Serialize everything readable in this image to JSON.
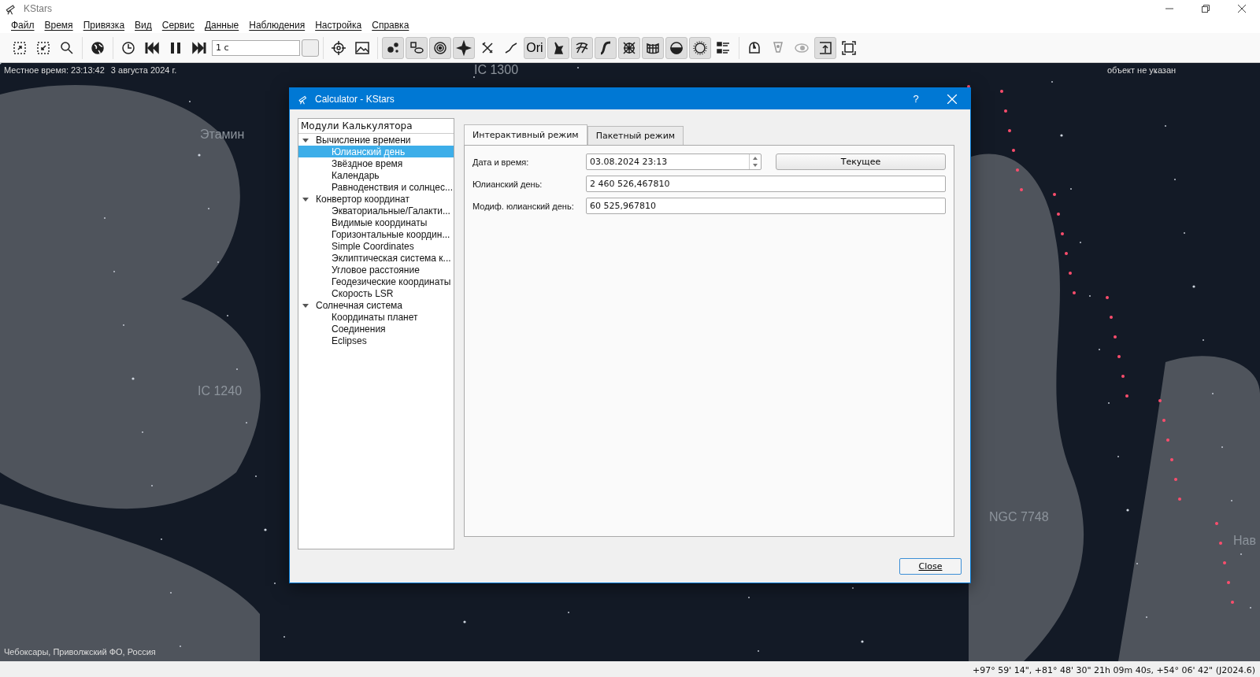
{
  "window": {
    "title": "KStars"
  },
  "menu": [
    "Файл",
    "Время",
    "Привязка",
    "Вид",
    "Сервис",
    "Данные",
    "Наблюдения",
    "Настройка",
    "Справка"
  ],
  "toolbar": {
    "groups": [
      [
        {
          "kind": "icon",
          "pressed": false
        },
        {
          "kind": "icon",
          "pressed": false
        },
        {
          "kind": "icon",
          "pressed": false
        }
      ],
      [
        {
          "kind": "icon",
          "pressed": false
        }
      ],
      [
        {
          "kind": "icon",
          "pressed": false
        },
        {
          "kind": "icon",
          "pressed": false
        },
        {
          "kind": "icon",
          "pressed": false
        },
        {
          "kind": "icon",
          "pressed": false
        },
        {
          "kind": "spin",
          "value": "1 с"
        }
      ],
      [
        {
          "kind": "icon",
          "pressed": false
        },
        {
          "kind": "icon",
          "pressed": false
        }
      ],
      [
        {
          "kind": "icon",
          "pressed": true
        },
        {
          "kind": "icon",
          "pressed": true
        },
        {
          "kind": "icon",
          "pressed": true
        },
        {
          "kind": "icon",
          "pressed": true
        },
        {
          "kind": "icon",
          "pressed": false
        },
        {
          "kind": "icon",
          "pressed": false
        },
        {
          "kind": "text",
          "label": "Ori",
          "pressed": true
        },
        {
          "kind": "icon",
          "pressed": true
        },
        {
          "kind": "icon",
          "pressed": true
        },
        {
          "kind": "icon",
          "pressed": true
        },
        {
          "kind": "icon",
          "pressed": true
        },
        {
          "kind": "icon",
          "pressed": true
        },
        {
          "kind": "icon",
          "pressed": true
        },
        {
          "kind": "icon",
          "pressed": true
        },
        {
          "kind": "icon",
          "pressed": false
        }
      ],
      [
        {
          "kind": "icon",
          "pressed": false
        },
        {
          "kind": "icon",
          "pressed": false
        },
        {
          "kind": "icon",
          "pressed": false
        },
        {
          "kind": "icon",
          "pressed": true
        },
        {
          "kind": "icon",
          "pressed": false
        }
      ]
    ]
  },
  "sky": {
    "local_time": "Местное время: 23:13:42",
    "date": "3 августа 2024 г.",
    "focus": "объект не указан",
    "location": "Чебоксары, Приволжский ФО, Россия",
    "labels": [
      "IC 1300",
      "Этамин",
      "IC 1240",
      "NGC 7748",
      "Нав"
    ]
  },
  "dialog": {
    "title": "Calculator - KStars",
    "help": "?",
    "tree": {
      "header": "Модули Калькулятора",
      "items": [
        {
          "label": "Вычисление времени",
          "expanded": true,
          "selected": false,
          "children": [
            {
              "label": "Юлианский день",
              "selected": true
            },
            {
              "label": "Звёздное время",
              "selected": false
            },
            {
              "label": "Календарь",
              "selected": false
            },
            {
              "label": "Равноденствия и солнцес...",
              "selected": false
            }
          ]
        },
        {
          "label": "Конвертор координат",
          "expanded": true,
          "selected": false,
          "children": [
            {
              "label": "Экваториальные/Галакти...",
              "selected": false
            },
            {
              "label": "Видимые координаты",
              "selected": false
            },
            {
              "label": "Горизонтальные координ...",
              "selected": false
            },
            {
              "label": "Simple Coordinates",
              "selected": false
            },
            {
              "label": "Эклиптическая система к...",
              "selected": false
            },
            {
              "label": "Угловое расстояние",
              "selected": false
            },
            {
              "label": "Геодезические координаты",
              "selected": false
            },
            {
              "label": "Скорость LSR",
              "selected": false
            }
          ]
        },
        {
          "label": "Солнечная система",
          "expanded": true,
          "selected": false,
          "children": [
            {
              "label": "Координаты планет",
              "selected": false
            },
            {
              "label": "Соединения",
              "selected": false
            },
            {
              "label": "Eclipses",
              "selected": false
            }
          ]
        }
      ]
    },
    "tabs": [
      {
        "label": "Интерактивный режим",
        "selected": true
      },
      {
        "label": "Пакетный режим",
        "selected": false
      }
    ],
    "fields": [
      {
        "kind": "datetime",
        "label": "Дата и время:",
        "value": "03.08.2024 23:13",
        "button": "Текущее"
      },
      {
        "kind": "text",
        "label": "Юлианский день:",
        "value": "2 460 526,467810"
      },
      {
        "kind": "text",
        "label": "Модиф. юлианский день:",
        "value": "60 525,967810"
      }
    ],
    "close_button": "Close"
  },
  "status_bar": {
    "coordinates": "+97° 59' 14\", +81° 48' 30\"  21h 09m 40s, +54° 06' 42\" (J2024.6)"
  }
}
